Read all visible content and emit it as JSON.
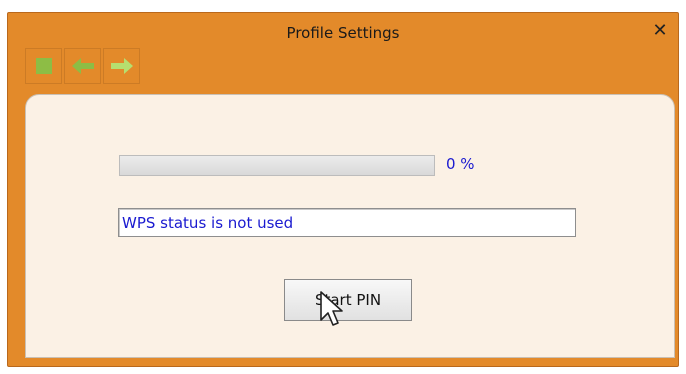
{
  "window": {
    "title": "Profile Settings",
    "close_label": "✕"
  },
  "toolbar": {
    "buttons": [
      "stop-icon",
      "back-arrow-icon",
      "forward-arrow-icon"
    ]
  },
  "progress": {
    "value": 0,
    "percent_label": "0 %"
  },
  "status": {
    "text": "WPS status is not used"
  },
  "actions": {
    "start_label": "Start PIN"
  },
  "colors": {
    "titlebar": "#e38a2a",
    "panel": "#fbf1e5",
    "accent_text": "#1a1ad0",
    "toolbar_icon": "#8dbd45"
  }
}
